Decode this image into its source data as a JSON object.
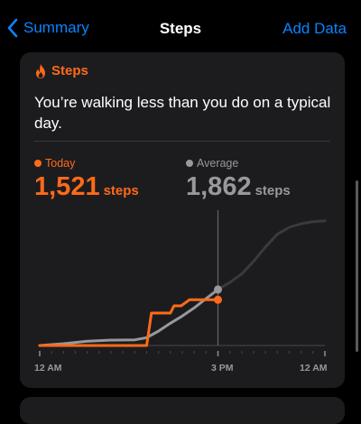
{
  "nav": {
    "back_label": "Summary",
    "title": "Steps",
    "action_label": "Add Data"
  },
  "card": {
    "title": "Steps",
    "title_icon": "flame-icon",
    "headline": "You’re walking less than you do on a typical day.",
    "today_label": "Today",
    "today_value": "1,521",
    "today_unit": "steps",
    "avg_label": "Average",
    "avg_value": "1,862",
    "avg_unit": "steps"
  },
  "colors": {
    "accent": "#0a84ff",
    "today": "#ff6a1a",
    "average": "#98989d",
    "card": "#1c1c1e"
  },
  "chart_data": {
    "type": "line",
    "xlabel": "",
    "ylabel": "",
    "x_ticks": [
      "12 AM",
      "3 PM",
      "12 AM"
    ],
    "current_time": "3 PM",
    "series": [
      {
        "name": "Today",
        "x": [
          0,
          5,
          8.5,
          9.0,
          9.4,
          11.0,
          11.3,
          11.9,
          12.6,
          13.5,
          14.1,
          15.0
        ],
        "y": [
          0,
          0,
          0,
          0,
          1080,
          1080,
          1320,
          1320,
          1521,
          1521,
          1521,
          1521
        ]
      },
      {
        "name": "Average",
        "x": [
          0,
          2,
          4,
          6,
          8,
          9,
          10,
          11,
          12,
          13,
          14,
          15,
          16,
          17,
          18,
          19,
          20,
          21,
          22,
          23,
          24
        ],
        "y": [
          0,
          60,
          140,
          180,
          190,
          260,
          480,
          740,
          980,
          1250,
          1560,
          1862,
          2100,
          2380,
          2800,
          3280,
          3700,
          3930,
          4050,
          4120,
          4150
        ]
      }
    ]
  }
}
